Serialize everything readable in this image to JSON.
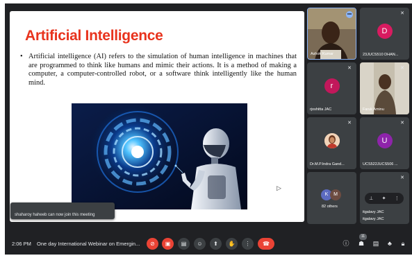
{
  "slide": {
    "title": "Artificial Intelligence",
    "bullet": "•",
    "body": "Artificial intelligence (AI) refers to the simulation of human intelligence in machines that are programmed to think like humans and mimic their actions. It is a method of making a computer, a computer-controlled robot, or a software think intelligently like the human mind."
  },
  "toast": {
    "text": "shaharoy haheeb can now join this meeting"
  },
  "participants": [
    {
      "name": "Ashok Kumar",
      "avatar_letter": "",
      "avatar_color": ""
    },
    {
      "name": "23JUCS510 DHAN...",
      "avatar_letter": "D",
      "avatar_color": "#d81b60"
    },
    {
      "name": "rjoshitta JAC",
      "avatar_letter": "r",
      "avatar_color": "#c2185b"
    },
    {
      "name": "Faruk Aminu",
      "avatar_letter": "",
      "avatar_color": ""
    },
    {
      "name": "Dr.M.P.Indra Gand...",
      "avatar_letter": "",
      "avatar_color": ""
    },
    {
      "name": "UCS522JUCS506 ...",
      "avatar_letter": "U",
      "avatar_color": "#8e24aa"
    }
  ],
  "others": {
    "label": "82 others",
    "letters": [
      "K",
      "M"
    ],
    "colors": [
      "#5c6bc0",
      "#6d4c41"
    ]
  },
  "pinned": {
    "name": "itgalavy JAC",
    "name_repeat": "itgalavy JAC"
  },
  "bottom_bar": {
    "time": "2:06 PM",
    "meeting_title": "One day International Webinar on Emergin...",
    "people_count": "11"
  },
  "colors": {
    "background": "#202124",
    "tile": "#3c4043",
    "accent_red": "#ea4335",
    "active_border": "#8ab4f8"
  },
  "icons": [
    "mic-off-icon",
    "camera-off-icon",
    "captions-icon",
    "emoji-icon",
    "present-icon",
    "raise-hand-icon",
    "more-options-icon",
    "end-call-icon",
    "info-icon",
    "people-icon",
    "chat-icon",
    "activities-icon",
    "lock-icon"
  ]
}
